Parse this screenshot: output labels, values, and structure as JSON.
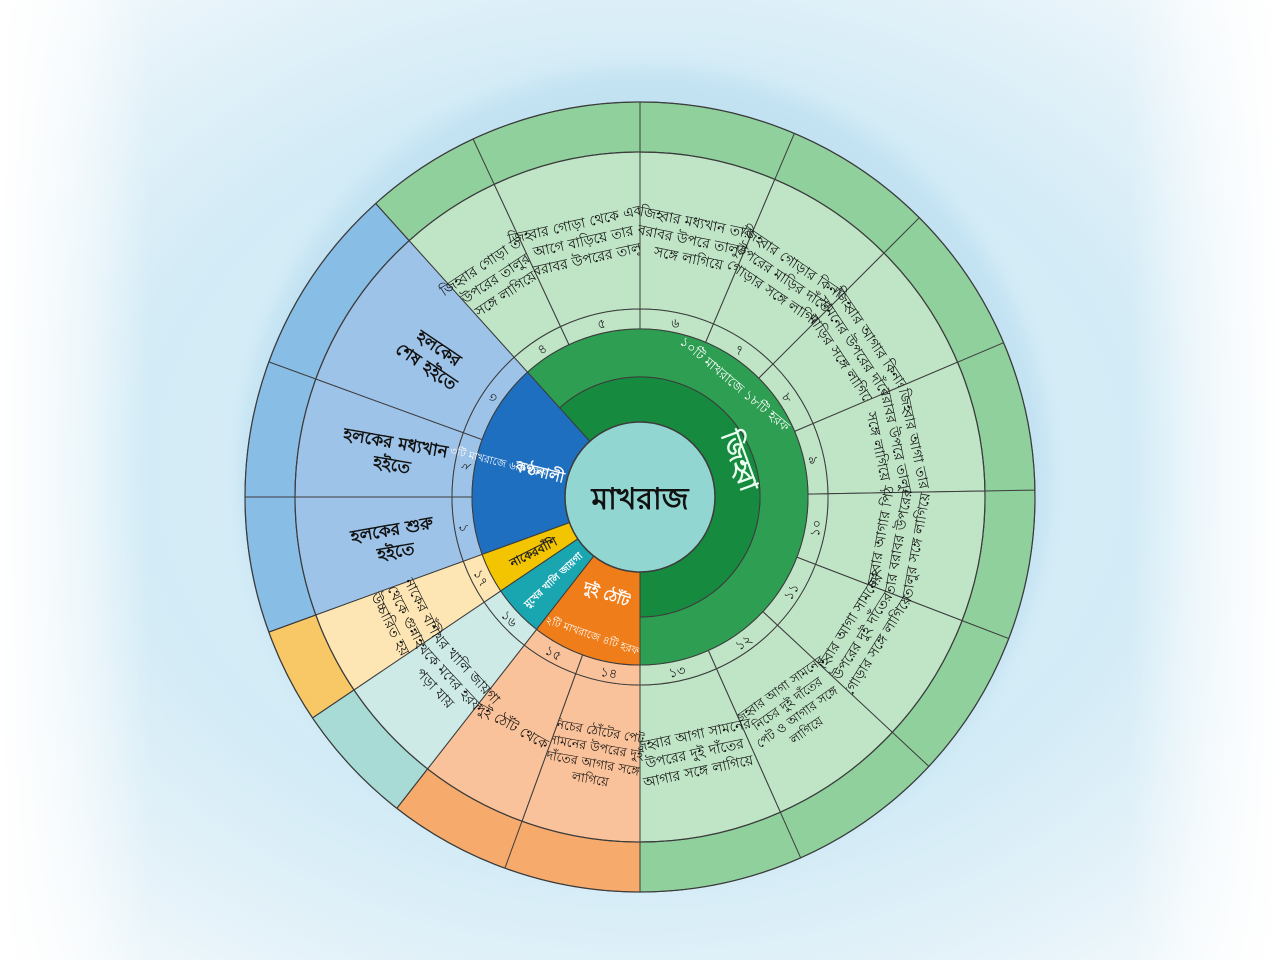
{
  "center_label": "মাখরাজ",
  "inner_groups": [
    {
      "key": "throat",
      "label": "কণ্ঠনালী",
      "caption": "৩টি মাখরাজে ৬টি হরফ",
      "color": "#1e6fbf"
    },
    {
      "key": "nose",
      "label": "নাকেরবাঁশি",
      "caption": "",
      "color": "#f2c500"
    },
    {
      "key": "mouth",
      "label": "মুখের খালি জায়গা",
      "caption": "",
      "color": "#1aa6b0"
    },
    {
      "key": "lips",
      "label": "দুই ঠোঁট",
      "caption": "২টি মাখরাজে ৪টি হরফ",
      "color": "#ef7d1a"
    },
    {
      "key": "tongue",
      "label": "জিহ্বা",
      "caption": "১০টি মাখরাজে ১৮টি হরফ",
      "color": "#1e9a47"
    }
  ],
  "segments": [
    {
      "number": "১",
      "text": [
        "হলকের শুরু",
        "হইতে"
      ],
      "group": "throat"
    },
    {
      "number": "২",
      "text": [
        "হলকের মধ্যখান",
        "হইতে"
      ],
      "group": "throat"
    },
    {
      "number": "৩",
      "text": [
        "হলকের",
        "শেষ হইতে"
      ],
      "group": "throat"
    },
    {
      "number": "৪",
      "text": [
        "জিহ্বার গোড়া তার",
        "উপরের তালুর",
        "সঙ্গে লাগিয়ে"
      ],
      "group": "tongue"
    },
    {
      "number": "৫",
      "text": [
        "জিহ্বার গোড়া থেকে একটু",
        "আগে বাড়িয়ে তার",
        "বরাবর উপরের তালু"
      ],
      "group": "tongue"
    },
    {
      "number": "৬",
      "text": [
        "জিহ্বার মধ্যখান তার",
        "বরাবর উপরে তালুর",
        "সঙ্গে লাগিয়ে"
      ],
      "group": "tongue"
    },
    {
      "number": "৭",
      "text": [
        "জিহ্বার গোড়ার কিনারা",
        "উপরের মাড়ির দাঁতের",
        "গোড়ার সঙ্গে লাগিয়ে"
      ],
      "group": "tongue"
    },
    {
      "number": "৮",
      "text": [
        "জিহ্বার আগার কিনারা",
        "সামনের উপরের দাঁতের",
        "মাড়ির সঙ্গে লাগিয়ে"
      ],
      "group": "tongue"
    },
    {
      "number": "৯",
      "text": [
        "জিহ্বার আগা তার",
        "বরাবর উপরে তালুর",
        "সঙ্গে লাগিয়ে"
      ],
      "group": "tongue"
    },
    {
      "number": "১০",
      "text": [
        "জিহ্বার আগার পিঠ",
        "তার বরাবর উপরের",
        "তালুর সঙ্গে লাগিয়ে"
      ],
      "group": "tongue"
    },
    {
      "number": "১১",
      "text": [
        "জিহ্বার আগা সামনের",
        "উপরের দুই দাঁতের",
        "গোড়ার সঙ্গে লাগিয়ে"
      ],
      "group": "tongue"
    },
    {
      "number": "১২",
      "text": [
        "জিহ্বার আগা সামনের",
        "নিচের দুই দাঁতের",
        "পেট ও আগার সঙ্গে",
        "লাগিয়ে"
      ],
      "group": "tongue"
    },
    {
      "number": "১৩",
      "text": [
        "জিহ্বার আগা সামনের",
        "উপরের দুই দাঁতের",
        "আগার সঙ্গে লাগিয়ে"
      ],
      "group": "tongue"
    },
    {
      "number": "১৪",
      "text": [
        "নিচের ঠোঁটের পেট",
        "সামনের উপরের দুই",
        "দাঁতের আগার সঙ্গে",
        "লাগিয়ে"
      ],
      "group": "lips"
    },
    {
      "number": "১৫",
      "text": [
        "দুই ঠোঁট থেকে"
      ],
      "group": "lips"
    },
    {
      "number": "১৬",
      "text": [
        "মুখের খালি জায়গা",
        "থেকে মদের হরফ",
        "পড়া যায়"
      ],
      "group": "mouth"
    },
    {
      "number": "১৭",
      "text": [
        "নাকের বাঁশী",
        "থেকে গুন্নাহ",
        "উচ্চারিত হয়"
      ],
      "group": "nose"
    }
  ],
  "colors": {
    "throat_light": "#9ec3e8",
    "throat_outer": "#88bde6",
    "nose_light": "#fde6b4",
    "nose_outer": "#f9c866",
    "mouth_light": "#cdeae6",
    "mouth_outer": "#a8dbd6",
    "lips_light": "#f9c29a",
    "lips_outer": "#f6aa6c",
    "tongue_light": "#bfe4c6",
    "tongue_outer": "#8fd09c",
    "tongue_ring_mid": "#2e9e52",
    "tongue_ring_dark": "#168a3e",
    "center_fill": "#92d6d2",
    "line": "#3c3c3c"
  }
}
